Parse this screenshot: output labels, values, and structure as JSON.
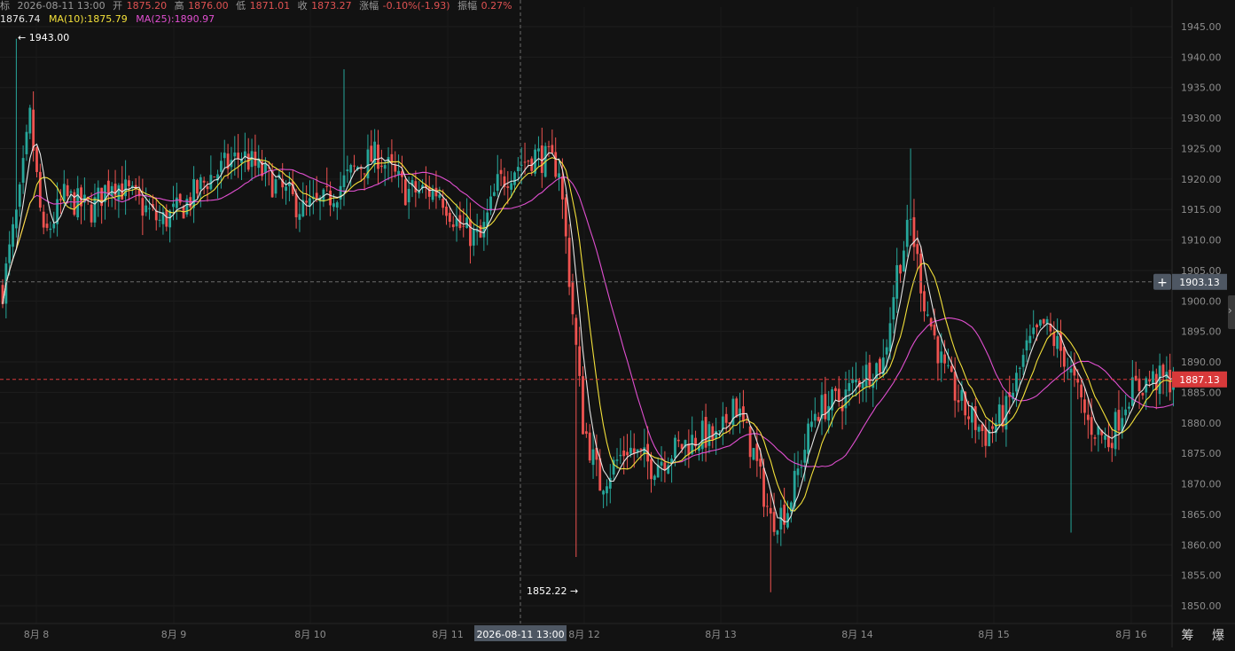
{
  "info_bar": {
    "prefix": "标",
    "datetime": "2026-08-11 13:00",
    "open_label": "开",
    "open": "1875.20",
    "high_label": "高",
    "high": "1876.00",
    "low_label": "低",
    "low": "1871.01",
    "close_label": "收",
    "close": "1873.27",
    "change_label": "涨幅",
    "change": "-0.10%(-1.93)",
    "amp_label": "振幅",
    "amp": "0.27%"
  },
  "ma_bar": {
    "ma5": "1876.74",
    "ma10": "MA(10):1875.79",
    "ma25": "MA(25):1890.97"
  },
  "annotations": {
    "high_marker": "← 1943.00",
    "low_marker": "1852.22 →"
  },
  "crosshair": {
    "price_label": "1903.13",
    "time_label": "2026-08-11 13:00",
    "add_icon": "plus-icon"
  },
  "current_price_label": "1887.13",
  "corner_tools": {
    "label": "筹 爆"
  },
  "colors": {
    "background": "#121212",
    "up": "#26a69a",
    "down": "#ef5350",
    "ma5": "#e6e6e6",
    "ma10": "#f3e03a",
    "ma25": "#e04fd0",
    "current_price": "#d8393a",
    "crosshair_label": "#4e5763"
  },
  "chart_data": {
    "type": "candlestick",
    "ylim": [
      1848,
      1947
    ],
    "y_ticks": [
      "1850.00",
      "1855.00",
      "1860.00",
      "1865.00",
      "1870.00",
      "1875.00",
      "1880.00",
      "1885.00",
      "1890.00",
      "1895.00",
      "1900.00",
      "1905.00",
      "1910.00",
      "1915.00",
      "1920.00",
      "1925.00",
      "1930.00",
      "1935.00",
      "1940.00",
      "1945.00"
    ],
    "x_labels": [
      "8月 8",
      "8月 9",
      "8月 10",
      "8月 11",
      "8月 12",
      "8月 13",
      "8月 14",
      "8月 15",
      "8月 16"
    ],
    "crosshair_price": 1903.13,
    "current_price": 1887.13,
    "series": [
      {
        "name": "MA(10)",
        "type": "line"
      },
      {
        "name": "MA(25)",
        "type": "line"
      }
    ],
    "anchors": [
      [
        0,
        1902
      ],
      [
        5,
        1917
      ],
      [
        8,
        1930
      ],
      [
        12,
        1910
      ],
      [
        18,
        1917
      ],
      [
        26,
        1915
      ],
      [
        32,
        1920
      ],
      [
        40,
        1916
      ],
      [
        46,
        1913
      ],
      [
        52,
        1915
      ],
      [
        60,
        1920
      ],
      [
        70,
        1924
      ],
      [
        80,
        1919
      ],
      [
        88,
        1915
      ],
      [
        94,
        1916
      ],
      [
        104,
        1922
      ],
      [
        110,
        1924
      ],
      [
        118,
        1918
      ],
      [
        128,
        1918
      ],
      [
        134,
        1912
      ],
      [
        140,
        1910
      ],
      [
        145,
        1919
      ],
      [
        150,
        1922
      ],
      [
        156,
        1924
      ],
      [
        163,
        1922
      ],
      [
        170,
        1880
      ],
      [
        175,
        1870
      ],
      [
        183,
        1876
      ],
      [
        190,
        1873
      ],
      [
        198,
        1876
      ],
      [
        205,
        1878
      ],
      [
        210,
        1877
      ],
      [
        214,
        1884
      ],
      [
        220,
        1875
      ],
      [
        225,
        1864
      ],
      [
        230,
        1866
      ],
      [
        238,
        1882
      ],
      [
        246,
        1884
      ],
      [
        252,
        1888
      ],
      [
        258,
        1890
      ],
      [
        262,
        1905
      ],
      [
        266,
        1913
      ],
      [
        270,
        1900
      ],
      [
        276,
        1888
      ],
      [
        282,
        1882
      ],
      [
        288,
        1878
      ],
      [
        294,
        1882
      ],
      [
        300,
        1892
      ],
      [
        305,
        1896
      ],
      [
        311,
        1891
      ],
      [
        318,
        1880
      ],
      [
        324,
        1877
      ],
      [
        330,
        1885
      ],
      [
        336,
        1887
      ],
      [
        343,
        1887
      ]
    ]
  }
}
